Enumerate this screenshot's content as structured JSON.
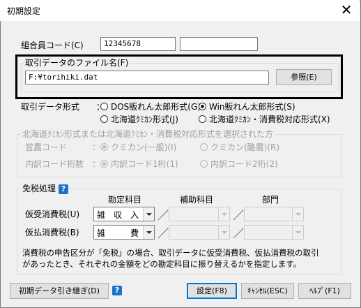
{
  "window": {
    "title": "初期設定",
    "close_glyph": "✕"
  },
  "member_code": {
    "label": "組合員コード(C)",
    "value": "12345678",
    "value2": ""
  },
  "file_group": {
    "label": "取引データのファイル名(F)",
    "value": "F:¥torihiki.dat",
    "browse_label": "参照(E)"
  },
  "format": {
    "label": "取引データ形式　　：",
    "options": [
      "DOS販れん太郎形式(G)",
      "Win販れん太郎形式(S)",
      "北海道ｸﾐｶﾝ形式(J)",
      "北海道ｸﾐｶﾝ・消費税対応形式(X)"
    ],
    "selected_index": 1
  },
  "hokkaido_group": {
    "label": "北海道ｸﾐｶﾝ形式または北海道ｸﾐｶﾝ・消費税対応形式を選択された方",
    "farm_code_label": "営農コード　　　：",
    "farm_options": [
      "クミカン(一般)(I)",
      "クミカン(酪農)(R)"
    ],
    "breakdown_label": "内訳コード桁数　：",
    "breakdown_options": [
      "内訳コード1桁(1)",
      "内訳コード2桁(2)"
    ]
  },
  "tax_group": {
    "label": "免税処理",
    "col_account": "勘定科目",
    "col_sub": "補助科目",
    "col_dept": "部門",
    "received_label": "仮受消費税(U)",
    "received_value": "雑　収　入",
    "paid_label": "仮払消費税(B)",
    "paid_value": "雑　　　費",
    "slash": "／",
    "note_line1": "消費税の申告区分が「免税」の場合、取引データに仮受消費税、仮払消費税の取引",
    "note_line2": "があったとき、それぞれの金額をどの勘定科目に振り替えるかを指定します。"
  },
  "footer": {
    "carry_over": "初期データ引き継ぎ(D)",
    "help_glyph": "?",
    "ok": "設定(F8)",
    "cancel": "ｷｬﾝｾﾙ(ESC)",
    "help": "ﾍﾙﾌﾟ(F1)"
  }
}
